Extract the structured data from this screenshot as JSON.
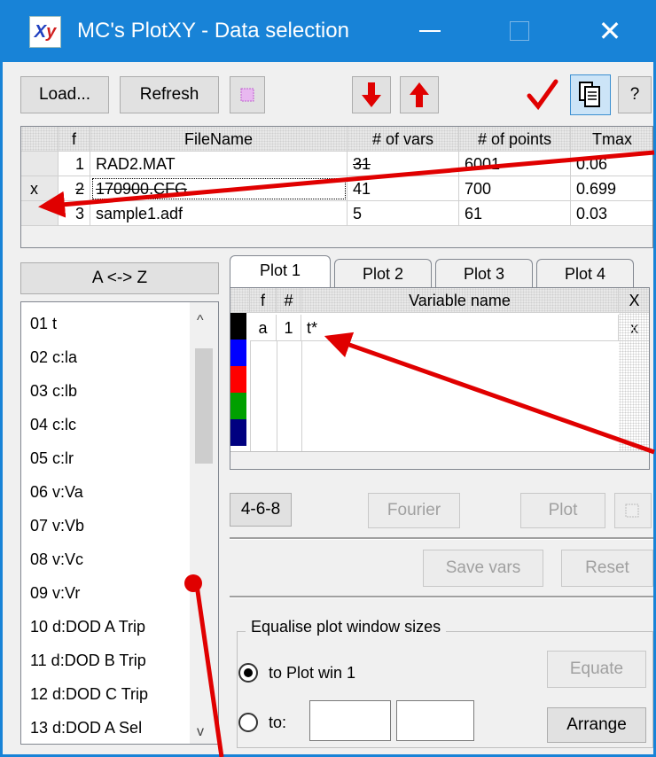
{
  "window": {
    "title": "MC's PlotXY - Data selection",
    "icon_text_x": "X",
    "icon_text_y": "y"
  },
  "toolbar": {
    "load_label": "Load...",
    "refresh_label": "Refresh",
    "help_label": "?"
  },
  "files": {
    "headers": [
      "f",
      "FileName",
      "# of vars",
      "# of points",
      "Tmax"
    ],
    "rows": [
      {
        "sel": "",
        "f": "1",
        "name": "RAD2.MAT",
        "vars": "31",
        "points": "6001",
        "tmax": "0.06"
      },
      {
        "sel": "x",
        "f": "2",
        "name": "170900.CFG",
        "vars": "41",
        "points": "700",
        "tmax": "0.699"
      },
      {
        "sel": "",
        "f": "3",
        "name": "sample1.adf",
        "vars": "5",
        "points": "61",
        "tmax": "0.03"
      }
    ]
  },
  "sort_button_label": "A <-> Z",
  "variables": [
    "01  t",
    "02  c:la",
    "03  c:lb",
    "04  c:lc",
    "05  c:lr",
    "06  v:Va",
    "07  v:Vb",
    "08  v:Vc",
    "09  v:Vr",
    "10  d:DOD A Trip",
    "11  d:DOD B Trip",
    "12  d:DOD C Trip",
    "13  d:DOD A Sel"
  ],
  "plot_tabs": [
    "Plot 1",
    "Plot 2",
    "Plot 3",
    "Plot 4"
  ],
  "plot_table": {
    "headers": [
      "f",
      "#",
      "Variable name",
      "X"
    ],
    "row": {
      "f": "a",
      "num": "1",
      "name": "t*",
      "x": "x"
    },
    "swatches": [
      "#000000",
      "#0000ff",
      "#ff0000",
      "#00a000",
      "#000080"
    ]
  },
  "buttons": {
    "b468": "4-6-8",
    "fourier": "Fourier",
    "plot": "Plot",
    "save_vars": "Save vars",
    "reset": "Reset",
    "equate": "Equate",
    "arrange": "Arrange"
  },
  "equalise": {
    "title": "Equalise plot window sizes",
    "opt1": "to Plot win 1",
    "opt2": "to:"
  },
  "colors": {
    "accent": "#1883d7",
    "annotation": "#e00000"
  }
}
